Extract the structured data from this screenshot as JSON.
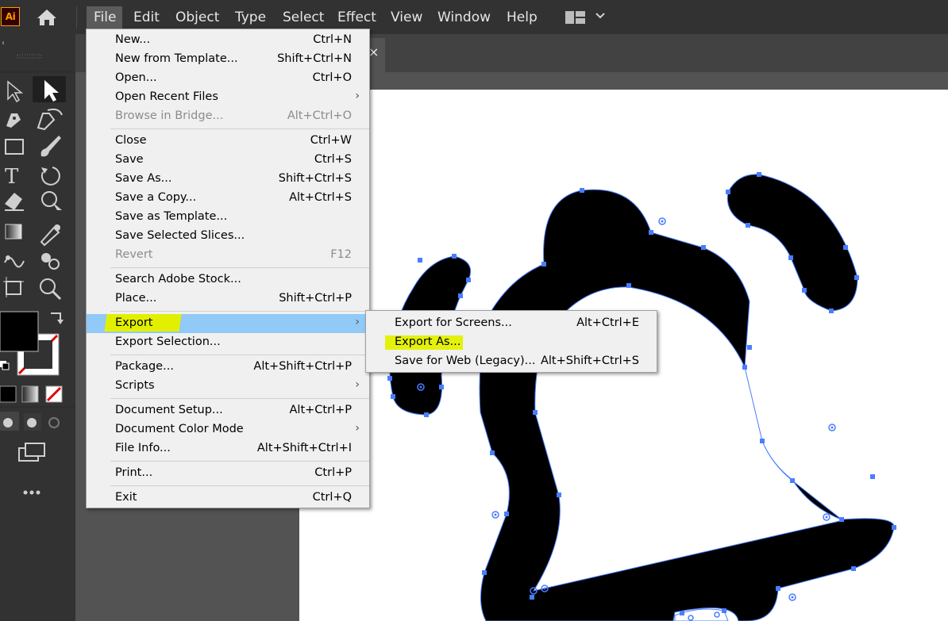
{
  "app": {
    "logo_text": "Ai"
  },
  "menubar": {
    "items": [
      "File",
      "Edit",
      "Object",
      "Type",
      "Select",
      "Effect",
      "View",
      "Window",
      "Help"
    ],
    "active": "File"
  },
  "document_tab": {
    "close_glyph": "×"
  },
  "file_menu": {
    "groups": [
      [
        {
          "label": "New...",
          "shortcut": "Ctrl+N"
        },
        {
          "label": "New from Template...",
          "shortcut": "Shift+Ctrl+N"
        },
        {
          "label": "Open...",
          "shortcut": "Ctrl+O"
        },
        {
          "label": "Open Recent Files",
          "submenu": true
        },
        {
          "label": "Browse in Bridge...",
          "shortcut": "Alt+Ctrl+O",
          "disabled": true
        }
      ],
      [
        {
          "label": "Close",
          "shortcut": "Ctrl+W"
        },
        {
          "label": "Save",
          "shortcut": "Ctrl+S"
        },
        {
          "label": "Save As...",
          "shortcut": "Shift+Ctrl+S"
        },
        {
          "label": "Save a Copy...",
          "shortcut": "Alt+Ctrl+S"
        },
        {
          "label": "Save as Template..."
        },
        {
          "label": "Save Selected Slices..."
        },
        {
          "label": "Revert",
          "shortcut": "F12",
          "disabled": true
        }
      ],
      [
        {
          "label": "Search Adobe Stock..."
        },
        {
          "label": "Place...",
          "shortcut": "Shift+Ctrl+P"
        }
      ],
      [
        {
          "label": "Export",
          "submenu": true,
          "highlighted": true
        },
        {
          "label": "Export Selection..."
        }
      ],
      [
        {
          "label": "Package...",
          "shortcut": "Alt+Shift+Ctrl+P"
        },
        {
          "label": "Scripts",
          "submenu": true
        }
      ],
      [
        {
          "label": "Document Setup...",
          "shortcut": "Alt+Ctrl+P"
        },
        {
          "label": "Document Color Mode",
          "submenu": true
        },
        {
          "label": "File Info...",
          "shortcut": "Alt+Shift+Ctrl+I"
        }
      ],
      [
        {
          "label": "Print...",
          "shortcut": "Ctrl+P"
        }
      ],
      [
        {
          "label": "Exit",
          "shortcut": "Ctrl+Q"
        }
      ]
    ]
  },
  "export_submenu": {
    "items": [
      {
        "label": "Export for Screens...",
        "shortcut": "Alt+Ctrl+E"
      },
      {
        "label": "Export As...",
        "marked": true
      },
      {
        "label": "Save for Web (Legacy)...",
        "shortcut": "Alt+Shift+Ctrl+S"
      }
    ]
  },
  "colors": {
    "menu_highlight": "#91c9f7",
    "marker_yellow": "#e2f000",
    "selection_blue": "#4a7dff",
    "app_orange": "#ff9a00"
  },
  "tools": [
    "direct-selection",
    "selection",
    "pen",
    "curvature",
    "rectangle",
    "paintbrush",
    "type",
    "rotate",
    "eraser",
    "puppet-warp",
    "gradient",
    "eyedropper",
    "blend",
    "shape-builder",
    "artboard",
    "zoom"
  ]
}
